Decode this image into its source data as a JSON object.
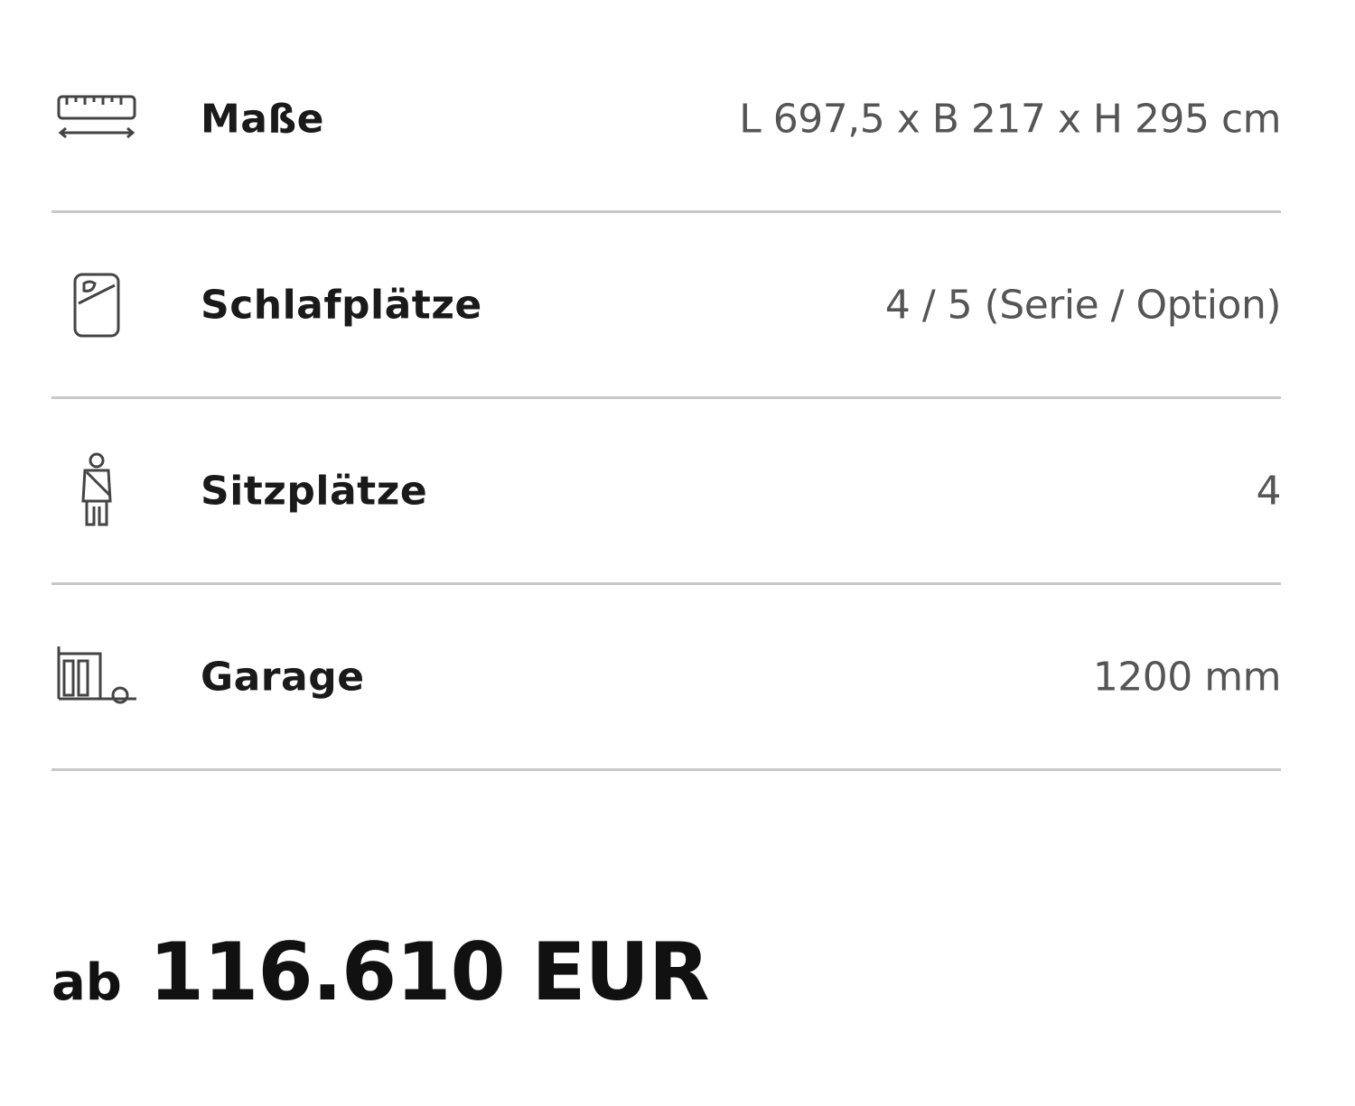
{
  "specs": [
    {
      "icon": "ruler-icon",
      "label": "Maße",
      "value": "L 697,5 x B 217 x H 295 cm"
    },
    {
      "icon": "sleeping-bag-icon",
      "label": "Schlafplätze",
      "value": "4 / 5 (Serie / Option)"
    },
    {
      "icon": "seatbelt-icon",
      "label": "Sitzplätze",
      "value": "4"
    },
    {
      "icon": "garage-icon",
      "label": "Garage",
      "value": "1200 mm"
    }
  ],
  "price": {
    "prefix": "ab",
    "amount": "116.610 EUR"
  },
  "colors": {
    "text": "#1a1a1a",
    "value": "#555555",
    "divider": "#c8c8c8"
  }
}
